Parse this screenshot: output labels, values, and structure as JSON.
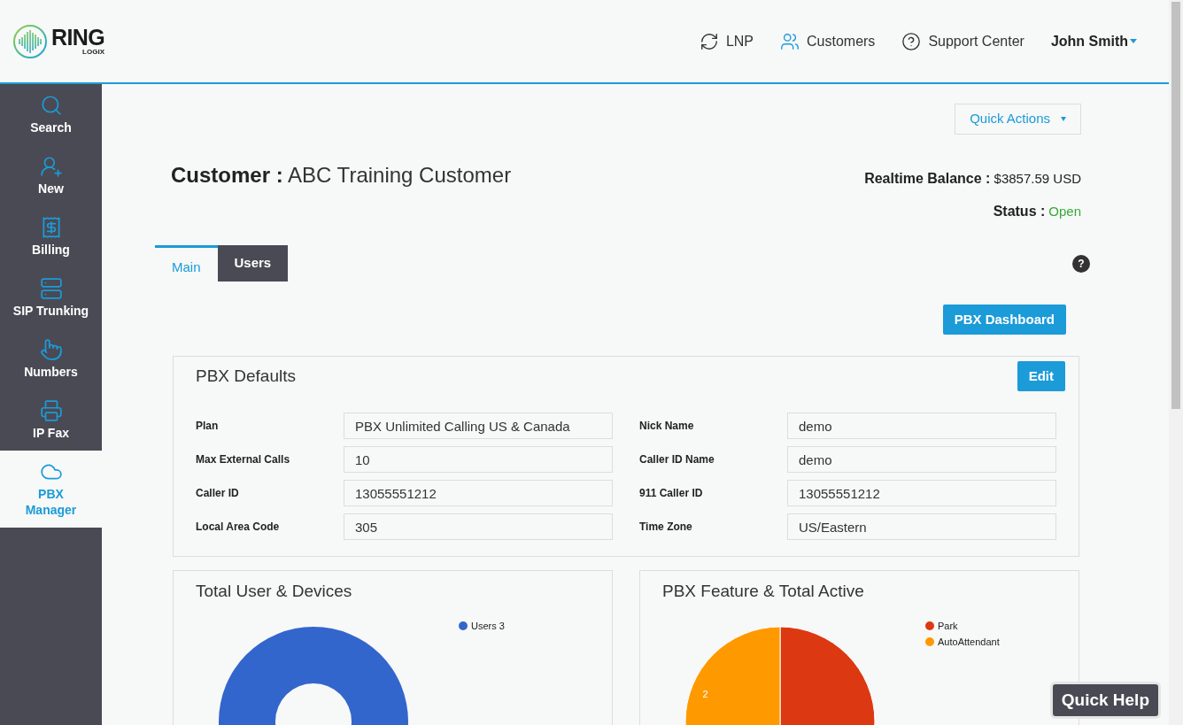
{
  "header": {
    "logo": {
      "name": "RING",
      "sub": "LOGIX"
    },
    "nav": [
      {
        "label": "LNP",
        "kind": "lnp"
      },
      {
        "label": "Customers",
        "kind": "customers"
      },
      {
        "label": "Support Center",
        "kind": "support"
      }
    ],
    "user": "John Smith"
  },
  "sidebar": {
    "items": [
      {
        "label": "Search",
        "kind": "search",
        "selected": false
      },
      {
        "label": "New",
        "kind": "new",
        "selected": false
      },
      {
        "label": "Billing",
        "kind": "billing",
        "selected": false
      },
      {
        "label": "SIP Trunking",
        "kind": "sip",
        "selected": false
      },
      {
        "label": "Numbers",
        "kind": "numbers",
        "selected": false
      },
      {
        "label": "IP Fax",
        "kind": "fax",
        "selected": false
      },
      {
        "label": "PBX Manager",
        "kind": "pbx",
        "selected": true
      }
    ]
  },
  "quick_actions": "Quick Actions",
  "customer": {
    "label": "Customer :",
    "name": "ABC Training Customer"
  },
  "balance": {
    "label": "Realtime Balance :",
    "value": "$3857.59 USD"
  },
  "status": {
    "label": "Status :",
    "value": "Open"
  },
  "tabs": [
    {
      "label": "Main",
      "selected": true
    },
    {
      "label": "Users",
      "selected": false
    }
  ],
  "help_icon": "?",
  "pbx_dashboard": "PBX Dashboard",
  "pbx_defaults": {
    "title": "PBX Defaults",
    "edit": "Edit",
    "fields": [
      {
        "label": "Plan",
        "value": "PBX Unlimited Calling US & Canada"
      },
      {
        "label": "Nick Name",
        "value": "demo"
      },
      {
        "label": "Max External Calls",
        "value": "10"
      },
      {
        "label": "Caller ID Name",
        "value": "demo"
      },
      {
        "label": "Caller ID",
        "value": "13055551212"
      },
      {
        "label": "911 Caller ID",
        "value": "13055551212"
      },
      {
        "label": "Local Area Code",
        "value": "305"
      },
      {
        "label": "Time Zone",
        "value": "US/Eastern"
      }
    ]
  },
  "charts": [
    {
      "title": "Total User & Devices",
      "chart_data": {
        "type": "donut",
        "categories": [
          "Users 3"
        ],
        "values": [
          3
        ],
        "colors": [
          "#3366cc"
        ],
        "legend": "right"
      }
    },
    {
      "title": "PBX Feature & Total Active",
      "chart_data": {
        "type": "pie",
        "categories": [
          "Park",
          "AutoAttendant"
        ],
        "values": [
          2,
          2
        ],
        "colors": [
          "#dc3912",
          "#ff9900"
        ],
        "legend": "right",
        "value_labels": [
          null,
          "2"
        ]
      }
    }
  ],
  "quick_help": "Quick Help"
}
